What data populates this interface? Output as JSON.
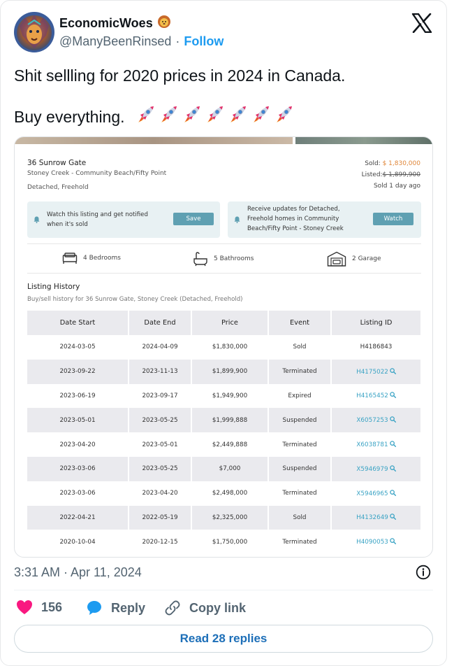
{
  "author": {
    "name": "EconomicWoes",
    "name_emoji": "lion-emoji",
    "handle": "@ManyBeenRinsed",
    "separator": "·",
    "follow_label": "Follow"
  },
  "tweet": {
    "line1": "Shit sellling for 2020 prices in 2024 in Canada.",
    "line2": "Buy everything.",
    "emoji": "rocket-emoji",
    "emoji_count": 7
  },
  "listing": {
    "address": "36 Sunrow Gate",
    "community": "Stoney Creek - Community Beach/Fifty Point",
    "type": "Detached, Freehold",
    "sold_label": "Sold:",
    "sold_price": "$ 1,830,000",
    "listed_label": "Listed:",
    "listed_price": "$ 1,899,900",
    "sold_ago": "Sold 1 day ago",
    "notice_watch": {
      "line1": "Watch this listing and get notified",
      "line2": "when it's sold",
      "button": "Save"
    },
    "notice_updates": {
      "line1": "Receive updates for Detached,",
      "line2": "Freehold homes in Community",
      "line3": "Beach/Fifty Point - Stoney Creek",
      "button": "Watch"
    },
    "features": {
      "bedrooms": "4 Bedrooms",
      "bathrooms": "5 Bathrooms",
      "garage": "2 Garage"
    },
    "history_title": "Listing History",
    "history_subtitle": "Buy/sell history for 36 Sunrow Gate, Stoney Creek (Detached, Freehold)",
    "history_headers": [
      "Date Start",
      "Date End",
      "Price",
      "Event",
      "Listing ID"
    ],
    "history_rows": [
      {
        "start": "2024-03-05",
        "end": "2024-04-09",
        "price": "$1,830,000",
        "event": "Sold",
        "id": "H4186843",
        "link": false
      },
      {
        "start": "2023-09-22",
        "end": "2023-11-13",
        "price": "$1,899,900",
        "event": "Terminated",
        "id": "H4175022",
        "link": true
      },
      {
        "start": "2023-06-19",
        "end": "2023-09-17",
        "price": "$1,949,900",
        "event": "Expired",
        "id": "H4165452",
        "link": true
      },
      {
        "start": "2023-05-01",
        "end": "2023-05-25",
        "price": "$1,999,888",
        "event": "Suspended",
        "id": "X6057253",
        "link": true
      },
      {
        "start": "2023-04-20",
        "end": "2023-05-01",
        "price": "$2,449,888",
        "event": "Terminated",
        "id": "X6038781",
        "link": true
      },
      {
        "start": "2023-03-06",
        "end": "2023-05-25",
        "price": "$7,000",
        "event": "Suspended",
        "id": "X5946979",
        "link": true
      },
      {
        "start": "2023-03-06",
        "end": "2023-04-20",
        "price": "$2,498,000",
        "event": "Terminated",
        "id": "X5946965",
        "link": true
      },
      {
        "start": "2022-04-21",
        "end": "2022-05-19",
        "price": "$2,325,000",
        "event": "Sold",
        "id": "H4132649",
        "link": true
      },
      {
        "start": "2020-10-04",
        "end": "2020-12-15",
        "price": "$1,750,000",
        "event": "Terminated",
        "id": "H4090053",
        "link": true
      }
    ]
  },
  "footer": {
    "timestamp": "3:31 AM · Apr 11, 2024",
    "likes": "156",
    "reply_label": "Reply",
    "copy_label": "Copy link",
    "read_replies": "Read 28 replies"
  },
  "colors": {
    "accent_blue": "#1d9bf0",
    "heart": "#f91880",
    "reply_bubble": "#1d9bf0",
    "sold_price": "#e0873a",
    "link_teal": "#3aa3c4",
    "button_teal": "#5fa0b2"
  }
}
